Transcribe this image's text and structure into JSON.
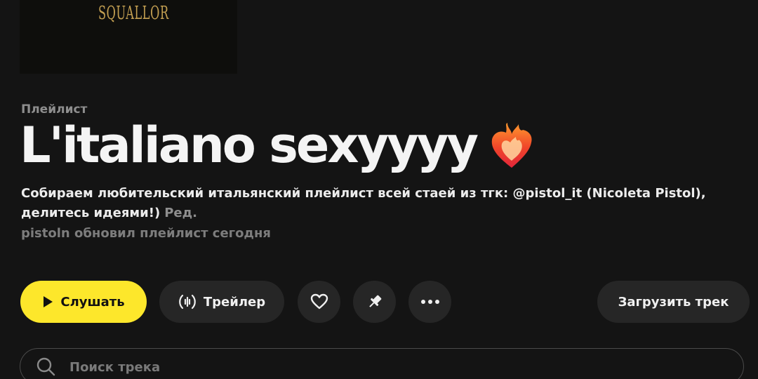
{
  "cover": {
    "art_text": "SQUALLOR"
  },
  "header": {
    "kind": "Плейлист",
    "title": "L'italiano sexyyyy",
    "title_emoji": "heart-on-fire-icon",
    "description": "Собираем любительский итальянский плейлист всей стаей из тгк: @pistol_it (Nicoleta Pistol), делитесь идеями!)",
    "edit_label": "Ред.",
    "updated": "pistoln обновил плейлист сегодня"
  },
  "actions": {
    "play_label": "Слушать",
    "trailer_label": "Трейлер",
    "like_icon": "heart-outline-icon",
    "pin_icon": "pin-icon",
    "more_icon": "more-dots-icon",
    "upload_label": "Загрузить трек"
  },
  "search": {
    "placeholder": "Поиск трека",
    "value": ""
  },
  "colors": {
    "background": "#141414",
    "accent": "#fde72b",
    "button_bg": "#262626",
    "muted_text": "#8e8e8e"
  }
}
